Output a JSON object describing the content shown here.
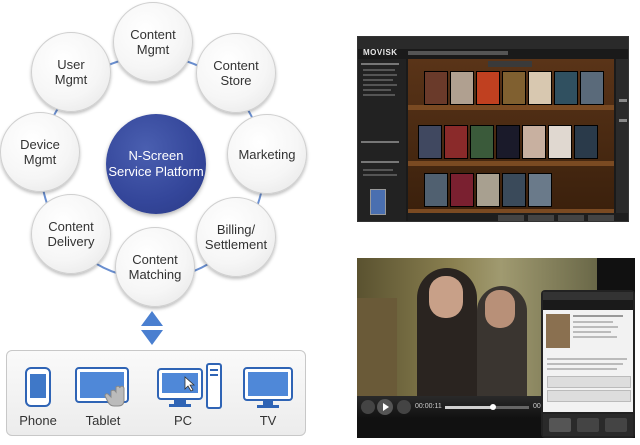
{
  "platform": {
    "line1": "N-Screen",
    "line2": "Service Platform"
  },
  "modules": [
    {
      "line1": "Content",
      "line2": "Mgmt"
    },
    {
      "line1": "Content",
      "line2": "Store"
    },
    {
      "line1": "Marketing",
      "line2": ""
    },
    {
      "line1": "Billing/",
      "line2": "Settlement"
    },
    {
      "line1": "Content",
      "line2": "Matching"
    },
    {
      "line1": "Content",
      "line2": "Delivery"
    },
    {
      "line1": "Device",
      "line2": "Mgmt"
    },
    {
      "line1": "User",
      "line2": "Mgmt"
    }
  ],
  "devices": [
    "Phone",
    "Tablet",
    "PC",
    "TV"
  ],
  "colors": {
    "core": "#34469a",
    "ring": "#6a8fd0",
    "arrow": "#4a7fd0",
    "device_blue": "#2f64b5"
  },
  "app_window": {
    "logo": "MOVISK"
  },
  "player": {
    "current_time": "00:00:11",
    "total_time": "00:06:45"
  }
}
